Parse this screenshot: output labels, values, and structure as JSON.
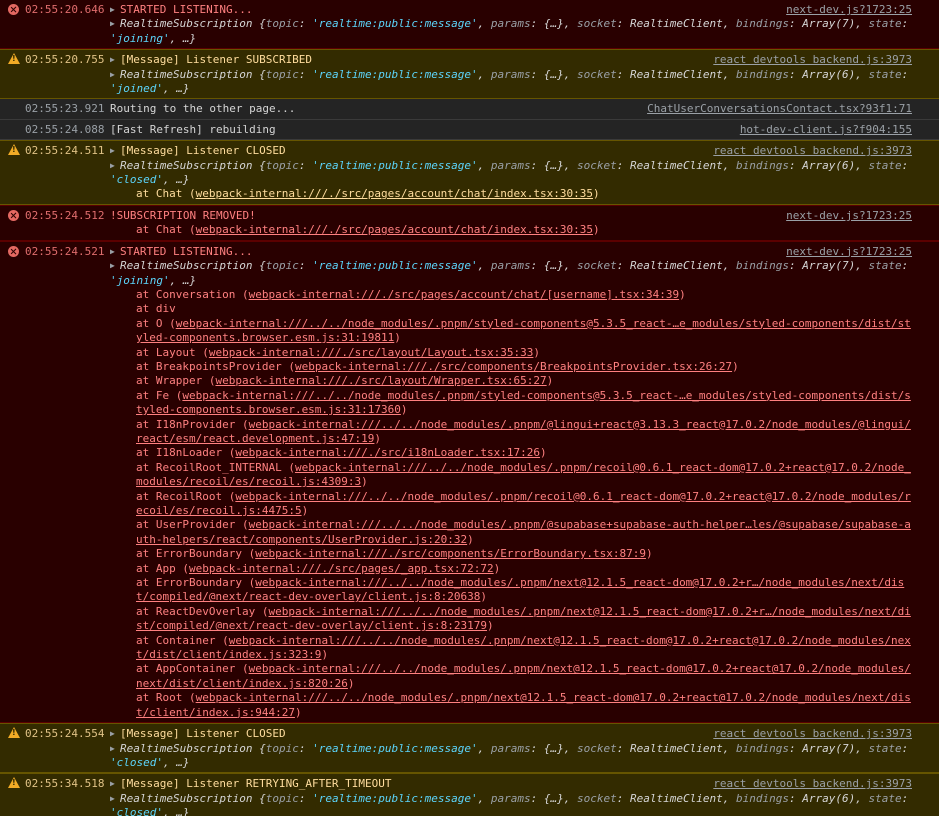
{
  "console": {
    "entries": [
      {
        "level": "error",
        "timestamp": "02:55:20.646",
        "source": "next-dev.js?1723:25",
        "message": "STARTED LISTENING...",
        "object": "RealtimeSubscription {topic: 'realtime:public:message', params: {…}, socket: RealtimeClient, bindings: Array(7), state: 'joining', …}",
        "stack": []
      },
      {
        "level": "warning",
        "timestamp": "02:55:20.755",
        "source": "react devtools backend.js:3973",
        "message": "[Message] Listener SUBSCRIBED",
        "object": "RealtimeSubscription {topic: 'realtime:public:message', params: {…}, socket: RealtimeClient, bindings: Array(6), state: 'joined', …}",
        "stack": []
      },
      {
        "level": "log",
        "timestamp": "02:55:23.921",
        "source": "ChatUserConversationsContact.tsx?93f1:71",
        "message": "Routing to the other page...",
        "object": "",
        "stack": []
      },
      {
        "level": "log",
        "timestamp": "02:55:24.088",
        "source": "hot-dev-client.js?f904:155",
        "message": "[Fast Refresh] rebuilding",
        "object": "",
        "stack": []
      },
      {
        "level": "warning",
        "timestamp": "02:55:24.511",
        "source": "react devtools backend.js:3973",
        "message": "[Message] Listener CLOSED",
        "object": "RealtimeSubscription {topic: 'realtime:public:message', params: {…}, socket: RealtimeClient, bindings: Array(6), state: 'closed', …}",
        "stack": [
          {
            "fn": "Chat",
            "loc": "webpack-internal:///./src/pages/account/chat/index.tsx:30:35"
          }
        ]
      },
      {
        "level": "error",
        "timestamp": "02:55:24.512",
        "source": "next-dev.js?1723:25",
        "message": "!SUBSCRIPTION REMOVED!",
        "object": "",
        "stack": [
          {
            "fn": "Chat",
            "loc": "webpack-internal:///./src/pages/account/chat/index.tsx:30:35"
          }
        ]
      },
      {
        "level": "error",
        "timestamp": "02:55:24.521",
        "source": "next-dev.js?1723:25",
        "message": "STARTED LISTENING...",
        "object": "RealtimeSubscription {topic: 'realtime:public:message', params: {…}, socket: RealtimeClient, bindings: Array(7), state: 'joining', …}",
        "stack": [
          {
            "fn": "Conversation",
            "loc": "webpack-internal:///./src/pages/account/chat/[username].tsx:34:39"
          },
          {
            "fn": "div",
            "loc": ""
          },
          {
            "fn": "O",
            "loc": "webpack-internal:///../../node_modules/.pnpm/styled-components@5.3.5_react-…e_modules/styled-components/dist/styled-components.browser.esm.js:31:19811"
          },
          {
            "fn": "Layout",
            "loc": "webpack-internal:///./src/layout/Layout.tsx:35:33"
          },
          {
            "fn": "BreakpointsProvider",
            "loc": "webpack-internal:///./src/components/BreakpointsProvider.tsx:26:27"
          },
          {
            "fn": "Wrapper",
            "loc": "webpack-internal:///./src/layout/Wrapper.tsx:65:27"
          },
          {
            "fn": "Fe",
            "loc": "webpack-internal:///../../node_modules/.pnpm/styled-components@5.3.5_react-…e_modules/styled-components/dist/styled-components.browser.esm.js:31:17360"
          },
          {
            "fn": "I18nProvider",
            "loc": "webpack-internal:///../../node_modules/.pnpm/@lingui+react@3.13.3_react@17.0.2/node_modules/@lingui/react/esm/react.development.js:47:19"
          },
          {
            "fn": "I18nLoader",
            "loc": "webpack-internal:///./src/i18nLoader.tsx:17:26"
          },
          {
            "fn": "RecoilRoot_INTERNAL",
            "loc": "webpack-internal:///../../node_modules/.pnpm/recoil@0.6.1_react-dom@17.0.2+react@17.0.2/node_modules/recoil/es/recoil.js:4309:3"
          },
          {
            "fn": "RecoilRoot",
            "loc": "webpack-internal:///../../node_modules/.pnpm/recoil@0.6.1_react-dom@17.0.2+react@17.0.2/node_modules/recoil/es/recoil.js:4475:5"
          },
          {
            "fn": "UserProvider",
            "loc": "webpack-internal:///../../node_modules/.pnpm/@supabase+supabase-auth-helper…les/@supabase/supabase-auth-helpers/react/components/UserProvider.js:20:32"
          },
          {
            "fn": "ErrorBoundary",
            "loc": "webpack-internal:///./src/components/ErrorBoundary.tsx:87:9"
          },
          {
            "fn": "App",
            "loc": "webpack-internal:///./src/pages/_app.tsx:72:72"
          },
          {
            "fn": "ErrorBoundary",
            "loc": "webpack-internal:///../../node_modules/.pnpm/next@12.1.5_react-dom@17.0.2+r…/node_modules/next/dist/compiled/@next/react-dev-overlay/client.js:8:20638"
          },
          {
            "fn": "ReactDevOverlay",
            "loc": "webpack-internal:///../../node_modules/.pnpm/next@12.1.5_react-dom@17.0.2+r…/node_modules/next/dist/compiled/@next/react-dev-overlay/client.js:8:23179"
          },
          {
            "fn": "Container",
            "loc": "webpack-internal:///../../node_modules/.pnpm/next@12.1.5_react-dom@17.0.2+react@17.0.2/node_modules/next/dist/client/index.js:323:9"
          },
          {
            "fn": "AppContainer",
            "loc": "webpack-internal:///../../node_modules/.pnpm/next@12.1.5_react-dom@17.0.2+react@17.0.2/node_modules/next/dist/client/index.js:820:26"
          },
          {
            "fn": "Root",
            "loc": "webpack-internal:///../../node_modules/.pnpm/next@12.1.5_react-dom@17.0.2+react@17.0.2/node_modules/next/dist/client/index.js:944:27"
          }
        ]
      },
      {
        "level": "warning",
        "timestamp": "02:55:24.554",
        "source": "react devtools backend.js:3973",
        "message": "[Message] Listener CLOSED",
        "object": "RealtimeSubscription {topic: 'realtime:public:message', params: {…}, socket: RealtimeClient, bindings: Array(7), state: 'closed', …}",
        "stack": []
      },
      {
        "level": "warning",
        "timestamp": "02:55:34.518",
        "source": "react devtools backend.js:3973",
        "message": "[Message] Listener RETRYING_AFTER_TIMEOUT",
        "object": "RealtimeSubscription {topic: 'realtime:public:message', params: {…}, socket: RealtimeClient, bindings: Array(6), state: 'closed', …}",
        "stack": []
      }
    ]
  },
  "colors": {
    "error_bg": "#290000",
    "error_text": "#ff8080",
    "warning_bg": "#332b00",
    "warning_text": "#ffdd9e",
    "log_bg": "#242424",
    "string_value": "#5cd5fb"
  }
}
